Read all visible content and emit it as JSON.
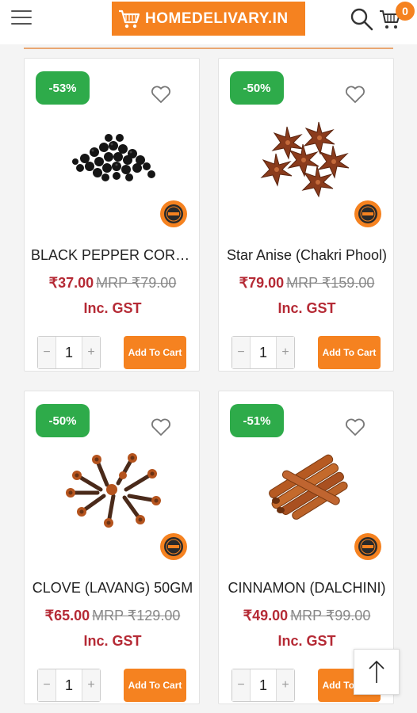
{
  "header": {
    "logo_text": "HOMEDELIVARY.IN",
    "cart_count": "0",
    "menu_icon": "hamburger-icon",
    "search_icon": "search-icon",
    "cart_icon": "cart-icon"
  },
  "colors": {
    "brand_orange": "#f58220",
    "discount_green": "#2eab4a",
    "price_red": "#b52a35"
  },
  "products": [
    {
      "discount": "-53%",
      "title": "BLACK PEPPER CORNS",
      "price": "₹37.00",
      "mrp": "MRP ₹79.00",
      "gst": "Inc. GST",
      "qty": "1",
      "add_label": "Add To Cart",
      "image": "black-pepper"
    },
    {
      "discount": "-50%",
      "title": "Star Anise (Chakri Phool)",
      "price": "₹79.00",
      "mrp": "MRP ₹159.00",
      "gst": "Inc. GST",
      "qty": "1",
      "add_label": "Add To Cart",
      "image": "star-anise"
    },
    {
      "discount": "-50%",
      "title": "CLOVE (LAVANG) 50GM",
      "price": "₹65.00",
      "mrp": "MRP ₹129.00",
      "gst": "Inc. GST",
      "qty": "1",
      "add_label": "Add To Cart",
      "image": "clove"
    },
    {
      "discount": "-51%",
      "title": "CINNAMON (DALCHINI)",
      "price": "₹49.00",
      "mrp": "MRP ₹99.00",
      "gst": "Inc. GST",
      "qty": "1",
      "add_label": "Add To Cart",
      "image": "cinnamon"
    }
  ],
  "scroll_top_icon": "arrow-up-icon"
}
